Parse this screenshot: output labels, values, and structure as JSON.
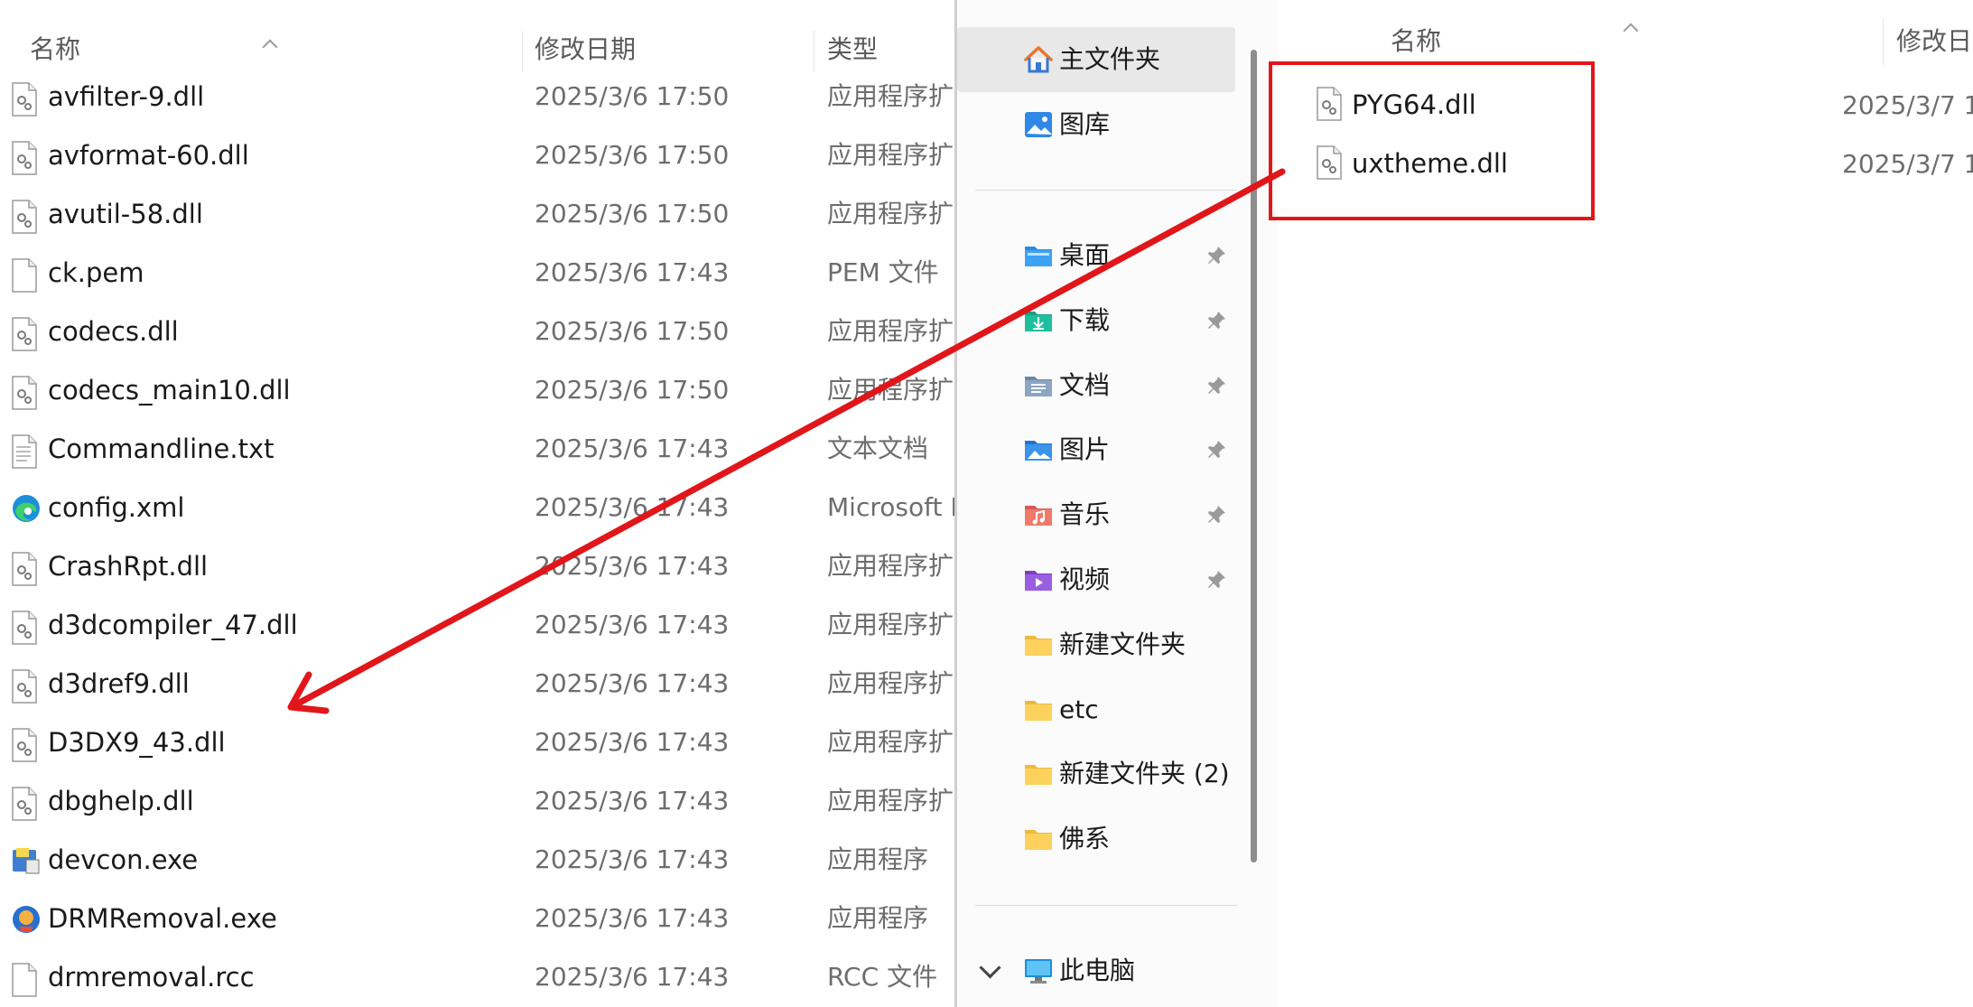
{
  "left_pane": {
    "columns": {
      "name": "名称",
      "date": "修改日期",
      "type": "类型"
    },
    "files": [
      {
        "name": "avfilter-9.dll",
        "date": "2025/3/6 17:50",
        "type": "应用程序扩展",
        "icon": "dll-file-icon"
      },
      {
        "name": "avformat-60.dll",
        "date": "2025/3/6 17:50",
        "type": "应用程序扩展",
        "icon": "dll-file-icon"
      },
      {
        "name": "avutil-58.dll",
        "date": "2025/3/6 17:50",
        "type": "应用程序扩展",
        "icon": "dll-file-icon"
      },
      {
        "name": "ck.pem",
        "date": "2025/3/6 17:43",
        "type": "PEM 文件",
        "icon": "blank-file-icon"
      },
      {
        "name": "codecs.dll",
        "date": "2025/3/6 17:50",
        "type": "应用程序扩展",
        "icon": "dll-file-icon"
      },
      {
        "name": "codecs_main10.dll",
        "date": "2025/3/6 17:50",
        "type": "应用程序扩展",
        "icon": "dll-file-icon"
      },
      {
        "name": "Commandline.txt",
        "date": "2025/3/6 17:43",
        "type": "文本文档",
        "icon": "text-file-icon"
      },
      {
        "name": "config.xml",
        "date": "2025/3/6 17:43",
        "type": "Microsoft Edge",
        "icon": "edge-icon"
      },
      {
        "name": "CrashRpt.dll",
        "date": "2025/3/6 17:43",
        "type": "应用程序扩展",
        "icon": "dll-file-icon"
      },
      {
        "name": "d3dcompiler_47.dll",
        "date": "2025/3/6 17:43",
        "type": "应用程序扩展",
        "icon": "dll-file-icon"
      },
      {
        "name": "d3dref9.dll",
        "date": "2025/3/6 17:43",
        "type": "应用程序扩展",
        "icon": "dll-file-icon"
      },
      {
        "name": "D3DX9_43.dll",
        "date": "2025/3/6 17:43",
        "type": "应用程序扩展",
        "icon": "dll-file-icon"
      },
      {
        "name": "dbghelp.dll",
        "date": "2025/3/6 17:43",
        "type": "应用程序扩展",
        "icon": "dll-file-icon"
      },
      {
        "name": "devcon.exe",
        "date": "2025/3/6 17:43",
        "type": "应用程序",
        "icon": "installer-exe-icon"
      },
      {
        "name": "DRMRemoval.exe",
        "date": "2025/3/6 17:43",
        "type": "应用程序",
        "icon": "drmremoval-app-icon"
      },
      {
        "name": "drmremoval.rcc",
        "date": "2025/3/6 17:43",
        "type": "RCC 文件",
        "icon": "blank-file-icon"
      }
    ]
  },
  "nav": {
    "items": [
      {
        "label": "主文件夹",
        "icon": "home-icon",
        "pinned": false,
        "selected": true
      },
      {
        "label": "图库",
        "icon": "gallery-icon",
        "pinned": false,
        "selected": false
      },
      {
        "label": "桌面",
        "icon": "desktop-folder-icon",
        "pinned": true,
        "selected": false
      },
      {
        "label": "下载",
        "icon": "downloads-folder-icon",
        "pinned": true,
        "selected": false
      },
      {
        "label": "文档",
        "icon": "documents-folder-icon",
        "pinned": true,
        "selected": false
      },
      {
        "label": "图片",
        "icon": "pictures-folder-icon",
        "pinned": true,
        "selected": false
      },
      {
        "label": "音乐",
        "icon": "music-folder-icon",
        "pinned": true,
        "selected": false
      },
      {
        "label": "视频",
        "icon": "videos-folder-icon",
        "pinned": true,
        "selected": false
      },
      {
        "label": "新建文件夹",
        "icon": "folder-icon",
        "pinned": false,
        "selected": false
      },
      {
        "label": "etc",
        "icon": "folder-icon",
        "pinned": false,
        "selected": false
      },
      {
        "label": "新建文件夹 (2)",
        "icon": "folder-icon",
        "pinned": false,
        "selected": false
      },
      {
        "label": "佛系",
        "icon": "folder-icon",
        "pinned": false,
        "selected": false
      },
      {
        "label": "此电脑",
        "icon": "this-pc-icon",
        "pinned": false,
        "selected": false
      }
    ]
  },
  "right_pane": {
    "columns": {
      "name": "名称",
      "date": "修改日期"
    },
    "files": [
      {
        "name": "PYG64.dll",
        "date": "2025/3/7 1",
        "icon": "dll-file-icon"
      },
      {
        "name": "uxtheme.dll",
        "date": "2025/3/7 1",
        "icon": "dll-file-icon"
      }
    ]
  },
  "annotation": {
    "highlight_color": "#e0161b",
    "arrow_color": "#e0161b"
  }
}
